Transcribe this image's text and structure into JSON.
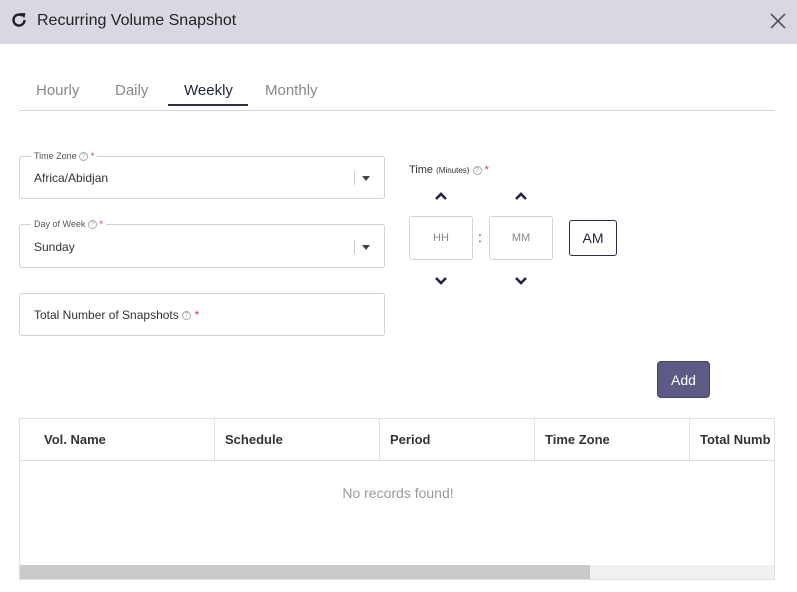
{
  "dialog": {
    "title": "Recurring Volume Snapshot"
  },
  "tabs": [
    {
      "label": "Hourly"
    },
    {
      "label": "Daily"
    },
    {
      "label": "Weekly"
    },
    {
      "label": "Monthly"
    }
  ],
  "active_tab": "Weekly",
  "form": {
    "time_zone": {
      "label": "Time Zone",
      "value": "Africa/Abidjan"
    },
    "day_of_week": {
      "label": "Day of Week",
      "value": "Sunday"
    },
    "total_snapshots": {
      "label": "Total Number of Snapshots",
      "value": ""
    },
    "required_mark": "*",
    "help_glyph": "?"
  },
  "time": {
    "label": "Time",
    "label_suffix": "(Minutes)",
    "hours_placeholder": "HH",
    "minutes_placeholder": "MM",
    "separator": ":",
    "meridiem": "AM"
  },
  "actions": {
    "add_label": "Add"
  },
  "table": {
    "columns": [
      "Vol. Name",
      "Schedule",
      "Period",
      "Time Zone",
      "Total Numb"
    ],
    "empty_message": "No records found!"
  },
  "colors": {
    "accent": "#5b5b85",
    "title_bar": "#d8d8e2",
    "required": "#d9363e"
  }
}
